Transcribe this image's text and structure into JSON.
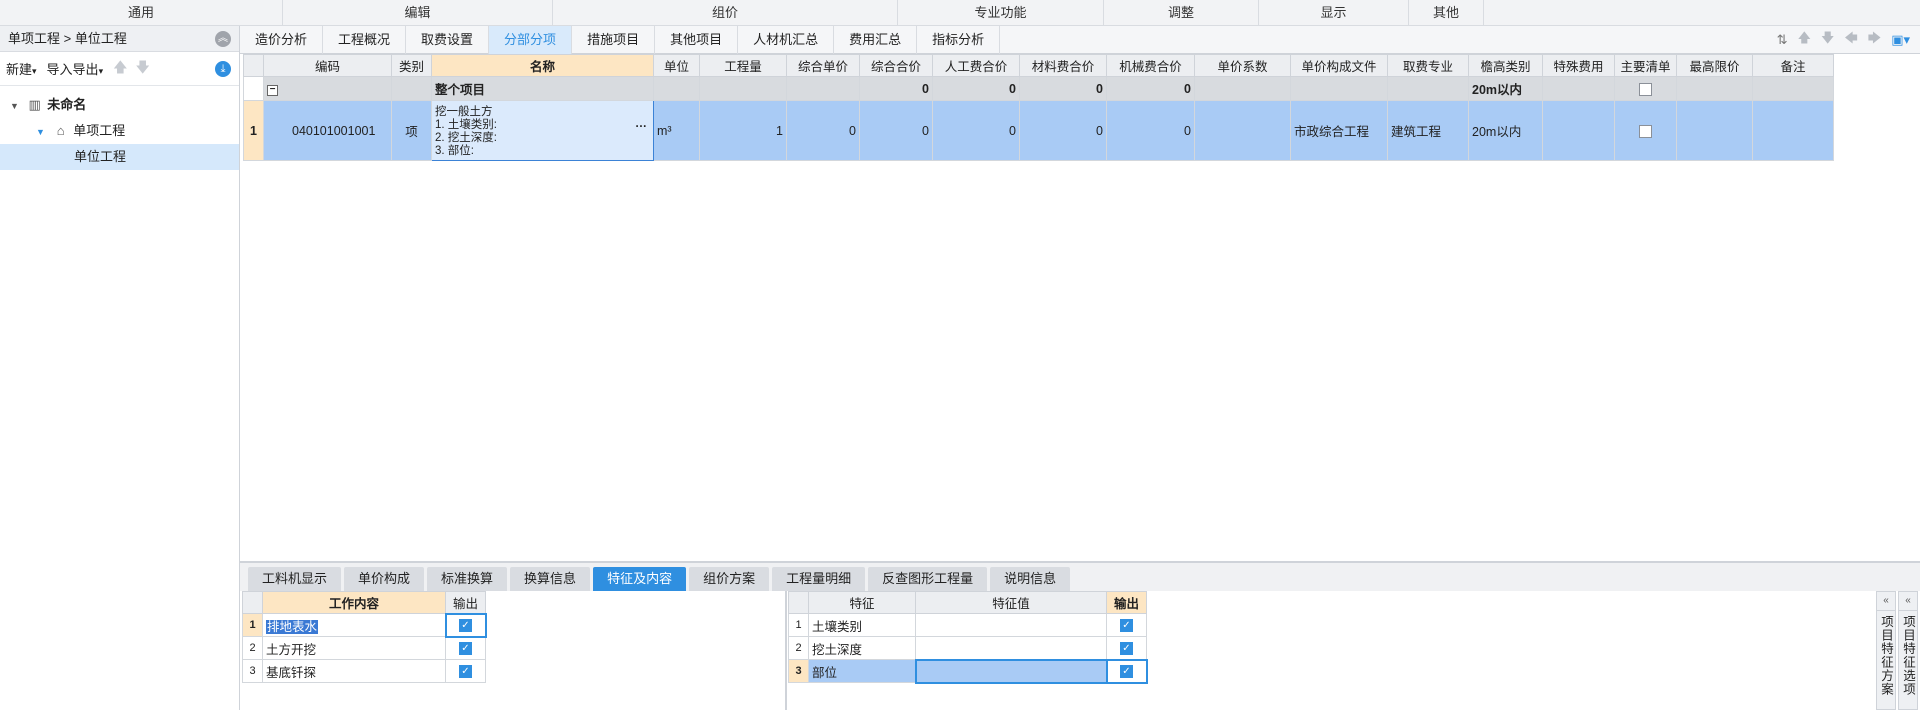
{
  "ribbon": {
    "groups": [
      "通用",
      "编辑",
      "组价",
      "专业功能",
      "调整",
      "显示",
      "其他"
    ]
  },
  "left": {
    "breadcrumb": "单项工程 > 单位工程",
    "toolbar": {
      "new_label": "新建",
      "import_export_label": "导入导出"
    },
    "tree": [
      {
        "label": "未命名"
      },
      {
        "label": "单项工程"
      },
      {
        "label": "单位工程"
      }
    ]
  },
  "tabs": [
    "造价分析",
    "工程概况",
    "取费设置",
    "分部分项",
    "措施项目",
    "其他项目",
    "人材机汇总",
    "费用汇总",
    "指标分析"
  ],
  "grid": {
    "headers": [
      "编码",
      "类别",
      "名称",
      "单位",
      "工程量",
      "综合单价",
      "综合合价",
      "人工费合价",
      "材料费合价",
      "机械费合价",
      "单价系数",
      "单价构成文件",
      "取费专业",
      "檐高类别",
      "特殊费用",
      "主要清单",
      "最高限价",
      "备注"
    ],
    "total_row": {
      "name": "整个项目",
      "composite_total": "0",
      "labor_total": "0",
      "material_total": "0",
      "machine_total": "0",
      "eave_height": "20m以内"
    },
    "rows": [
      {
        "row_no": "1",
        "code": "040101001001",
        "category": "项",
        "name_lines": [
          "挖一般土方",
          "1. 土壤类别:",
          "2. 挖土深度:",
          "3. 部位:"
        ],
        "unit": "m³",
        "quantity": "1",
        "unit_price": "0",
        "composite_total": "0",
        "labor_total": "0",
        "material_total": "0",
        "machine_total": "0",
        "composition_file": "市政综合工程",
        "fee_specialty": "建筑工程",
        "eave_height": "20m以内"
      }
    ]
  },
  "bottom_tabs": [
    "工料机显示",
    "单价构成",
    "标准换算",
    "换算信息",
    "特征及内容",
    "组价方案",
    "工程量明细",
    "反查图形工程量",
    "说明信息"
  ],
  "work_content": {
    "headers": [
      "工作内容",
      "输出"
    ],
    "rows": [
      {
        "no": "1",
        "content": "排地表水"
      },
      {
        "no": "2",
        "content": "土方开挖"
      },
      {
        "no": "3",
        "content": "基底钎探"
      }
    ]
  },
  "features": {
    "headers": [
      "特征",
      "特征值",
      "输出"
    ],
    "rows": [
      {
        "no": "1",
        "feature": "土壤类别",
        "value": ""
      },
      {
        "no": "2",
        "feature": "挖土深度",
        "value": ""
      },
      {
        "no": "3",
        "feature": "部位",
        "value": ""
      }
    ]
  },
  "side_tabs": {
    "scheme": "项目特征方案",
    "options": "项目特征选项"
  }
}
